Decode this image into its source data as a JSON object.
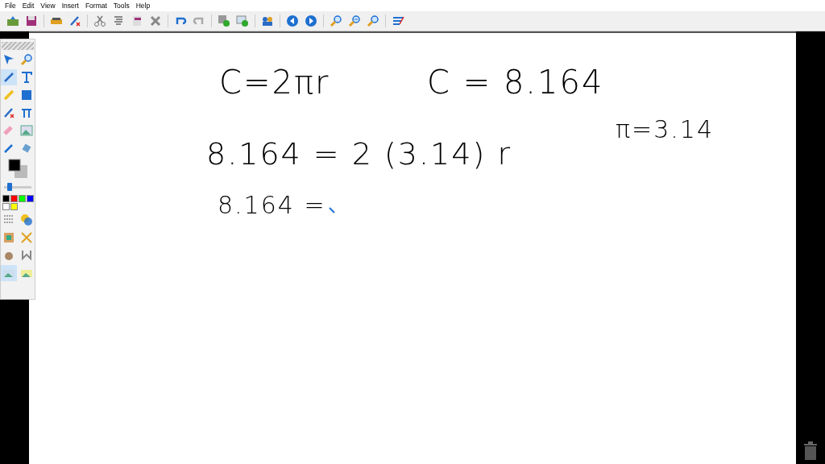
{
  "menu": [
    "File",
    "Edit",
    "View",
    "Insert",
    "Format",
    "Tools",
    "Help"
  ],
  "palette": {
    "tools": [
      {
        "selected": false
      },
      {
        "selected": false
      },
      {
        "selected": true
      },
      {
        "selected": false
      },
      {
        "selected": false
      },
      {
        "selected": false
      },
      {
        "selected": false
      },
      {
        "selected": false
      },
      {
        "selected": false
      },
      {
        "selected": false
      },
      {
        "selected": false
      },
      {
        "selected": false
      }
    ],
    "width_slider": {
      "level": 0.2
    },
    "swatches": [
      {
        "color": "#000000"
      },
      {
        "color": "#ff0000"
      },
      {
        "color": "#00ff00"
      },
      {
        "color": "#0000ff"
      },
      {
        "color": "#ffffff"
      },
      {
        "color": "#ffff00"
      }
    ],
    "modes": [
      {
        "selected": true
      },
      {
        "selected": false
      }
    ]
  },
  "canvas": {
    "ink": [
      "C=2πr",
      "C = 8.164",
      "π=3.14",
      "8.164 = 2 (3.14) r",
      "8.164 ="
    ]
  }
}
